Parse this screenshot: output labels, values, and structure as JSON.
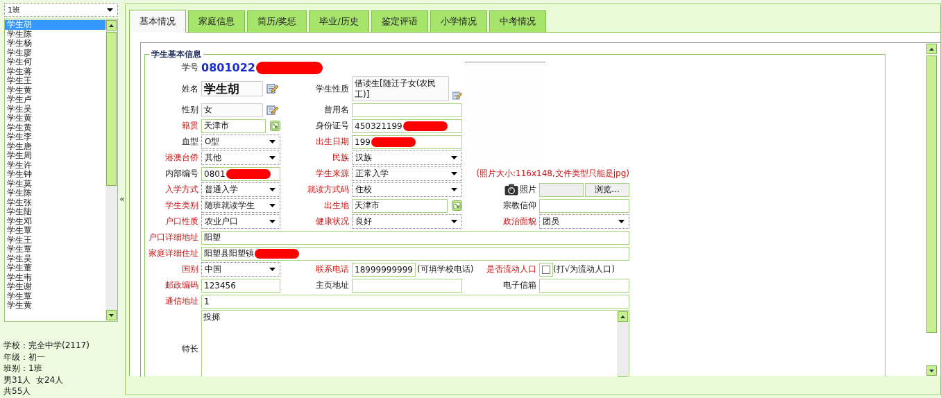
{
  "sidebar": {
    "class_select": {
      "value": "1班"
    },
    "students": [
      {
        "name": "学生胡",
        "selected": true
      },
      {
        "name": "学生陈",
        "selected": false
      },
      {
        "name": "学生杨",
        "selected": false
      },
      {
        "name": "学生廖",
        "selected": false
      },
      {
        "name": "学生何",
        "selected": false
      },
      {
        "name": "学生蒋",
        "selected": false
      },
      {
        "name": "学生王",
        "selected": false
      },
      {
        "name": "学生黄",
        "selected": false
      },
      {
        "name": "学生卢",
        "selected": false
      },
      {
        "name": "学生吴",
        "selected": false
      },
      {
        "name": "学生黄",
        "selected": false
      },
      {
        "name": "学生黄",
        "selected": false
      },
      {
        "name": "学生李",
        "selected": false
      },
      {
        "name": "学生唐",
        "selected": false
      },
      {
        "name": "学生周",
        "selected": false
      },
      {
        "name": "学生许",
        "selected": false
      },
      {
        "name": "学生钟",
        "selected": false
      },
      {
        "name": "学生莫",
        "selected": false
      },
      {
        "name": "学生陈",
        "selected": false
      },
      {
        "name": "学生张",
        "selected": false
      },
      {
        "name": "学生陆",
        "selected": false
      },
      {
        "name": "学生邓",
        "selected": false
      },
      {
        "name": "学生覃",
        "selected": false
      },
      {
        "name": "学生王",
        "selected": false
      },
      {
        "name": "学生覃",
        "selected": false
      },
      {
        "name": "学生吴",
        "selected": false
      },
      {
        "name": "学生董",
        "selected": false
      },
      {
        "name": "学生韦",
        "selected": false
      },
      {
        "name": "学生谢",
        "selected": false
      },
      {
        "name": "学生覃",
        "selected": false
      },
      {
        "name": "学生黄",
        "selected": false
      }
    ],
    "summary": [
      "学校：完全中学(2117)",
      "年级：初一",
      "班别：1班",
      "男31人  女24人",
      "共55人"
    ]
  },
  "collapse_button": "«",
  "tabs": [
    {
      "label": "基本情况",
      "selected": true
    },
    {
      "label": "家庭信息",
      "selected": false
    },
    {
      "label": "简历/奖惩",
      "selected": false
    },
    {
      "label": "毕业/历史",
      "selected": false
    },
    {
      "label": "鉴定评语",
      "selected": false
    },
    {
      "label": "小学情况",
      "selected": false
    },
    {
      "label": "中考情况",
      "selected": false
    }
  ],
  "form": {
    "legend": "学生基本信息",
    "student_no": {
      "label": "学号",
      "value": "0801022",
      "redacted": true
    },
    "rows": [
      [
        {
          "kind": "name",
          "label": "姓名",
          "required": false,
          "value": "学生胡"
        },
        {
          "kind": "multiline",
          "label": "学生性质",
          "required": false,
          "value": "借读生[随迁子女(农民工)]"
        }
      ],
      [
        {
          "kind": "edit",
          "label": "性别",
          "required": false,
          "value": "女"
        },
        {
          "kind": "text",
          "label": "曾用名",
          "required": false
        }
      ],
      [
        {
          "kind": "picker",
          "label": "籍贯",
          "required": true,
          "value": "天津市"
        },
        {
          "kind": "text",
          "label": "身份证号",
          "required": false,
          "value": "450321199",
          "redacted": true
        }
      ],
      [
        {
          "kind": "select",
          "label": "血型",
          "required": false,
          "value": "O型"
        },
        {
          "kind": "text",
          "label": "出生日期",
          "required": true,
          "value": "199",
          "redacted": true
        }
      ],
      [
        {
          "kind": "select",
          "label": "港澳台侨",
          "required": true,
          "value": "其他"
        },
        {
          "kind": "select",
          "label": "民族",
          "required": true,
          "value": "汉族"
        }
      ],
      [
        {
          "kind": "text",
          "label": "内部编号",
          "required": false,
          "value": "0801",
          "redacted": true
        },
        {
          "kind": "select",
          "label": "学生来源",
          "required": true,
          "value": "正常入学"
        },
        {
          "kind": "hint",
          "text": "(照片大小:116x148,文件类型只能是jpg)"
        }
      ],
      [
        {
          "kind": "select",
          "label": "入学方式",
          "required": true,
          "value": "普通入学"
        },
        {
          "kind": "select",
          "label": "就读方式码",
          "required": true,
          "value": "住校"
        },
        {
          "kind": "file",
          "label": "照片",
          "button": "浏览..."
        }
      ],
      [
        {
          "kind": "select",
          "label": "学生类别",
          "required": true,
          "value": "随班就读学生"
        },
        {
          "kind": "picker",
          "label": "出生地",
          "required": true,
          "value": "天津市"
        },
        {
          "kind": "text",
          "label": "宗教信仰",
          "required": false
        }
      ],
      [
        {
          "kind": "select",
          "label": "户口性质",
          "required": true,
          "value": "农业户口"
        },
        {
          "kind": "select",
          "label": "健康状况",
          "required": true,
          "value": "良好"
        },
        {
          "kind": "select",
          "label": "政治面貌",
          "required": true,
          "value": "团员"
        }
      ],
      [
        {
          "kind": "wide",
          "label": "户口详细地址",
          "required": true,
          "value": "阳塑"
        }
      ],
      [
        {
          "kind": "wide",
          "label": "家庭详细住址",
          "required": true,
          "value": "阳塑县阳塑镇",
          "redacted": true
        }
      ],
      [
        {
          "kind": "select",
          "label": "国别",
          "required": true,
          "value": "中国"
        },
        {
          "kind": "text",
          "label": "联系电话",
          "required": true,
          "value": "18999999999",
          "note": "(可填学校电话)"
        },
        {
          "kind": "checkbox",
          "label": "是否流动人口",
          "required": true,
          "checked": false,
          "note": "(打√为流动人口)"
        }
      ],
      [
        {
          "kind": "text",
          "label": "邮政编码",
          "required": true,
          "value": "123456"
        },
        {
          "kind": "text",
          "label": "主页地址",
          "required": false
        },
        {
          "kind": "text",
          "label": "电子信箱",
          "required": false
        }
      ],
      [
        {
          "kind": "wide",
          "label": "通信地址",
          "required": true,
          "value": "1"
        }
      ],
      [
        {
          "kind": "textarea",
          "label": "特长",
          "required": false,
          "value": "投掷"
        }
      ]
    ]
  }
}
